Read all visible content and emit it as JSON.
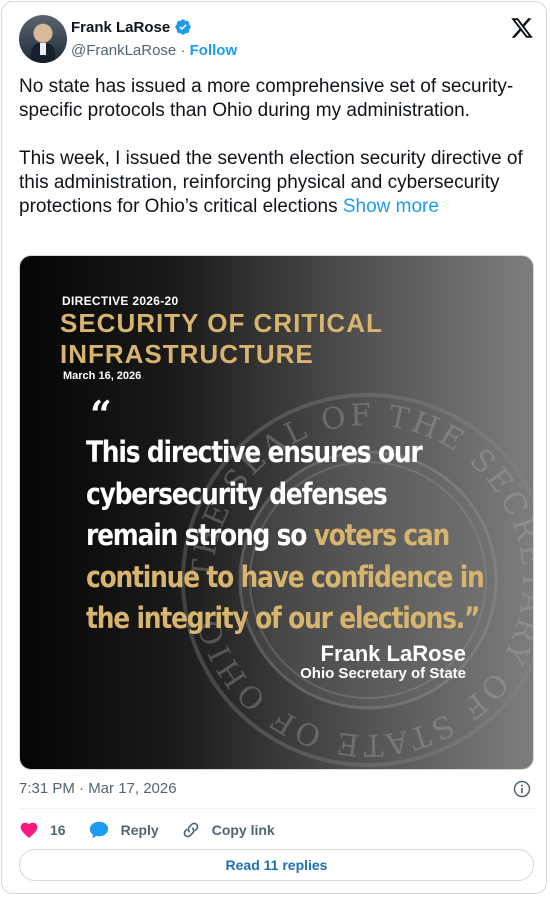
{
  "author": {
    "name": "Frank LaRose",
    "handle": "@FrankLaRose",
    "separator": "·",
    "follow_label": "Follow"
  },
  "tweet": {
    "paragraph1": "No state has issued a more comprehensive set of security-specific protocols than Ohio during my administration.",
    "paragraph2": "This week, I issued the seventh election security directive of this administration, reinforcing physical and cybersecurity protections for Ohio’s critical elections",
    "show_more": "Show more"
  },
  "media": {
    "directive": "DIRECTIVE 2026-20",
    "title_line1": "SECURITY OF CRITICAL",
    "title_line2": "INFRASTRUCTURE",
    "date": "March 16, 2026",
    "quote_mark": "“",
    "quote_line1": "This directive ensures our",
    "quote_line2": "cybersecurity defenses",
    "quote_line3_white": "remain strong so ",
    "quote_line3_gold": "voters can",
    "quote_line4": "continue to have confidence in",
    "quote_line5": "the integrity of our elections.”",
    "signature_name": "Frank LaRose",
    "signature_title": "Ohio Secretary of State",
    "seal_text": "THE SEAL OF THE SECRETARY OF STATE OF OHIO",
    "colors": {
      "gold": "#d8b56f",
      "background_dark": "#050505"
    }
  },
  "meta": {
    "timestamp": "7:31 PM · Mar 17, 2026"
  },
  "actions": {
    "like_count": "16",
    "reply_label": "Reply",
    "copy_link_label": "Copy link"
  },
  "read_replies_label": "Read 11 replies",
  "colors": {
    "accent": "#1d9bf0",
    "like": "#f91880",
    "muted": "#536471"
  }
}
